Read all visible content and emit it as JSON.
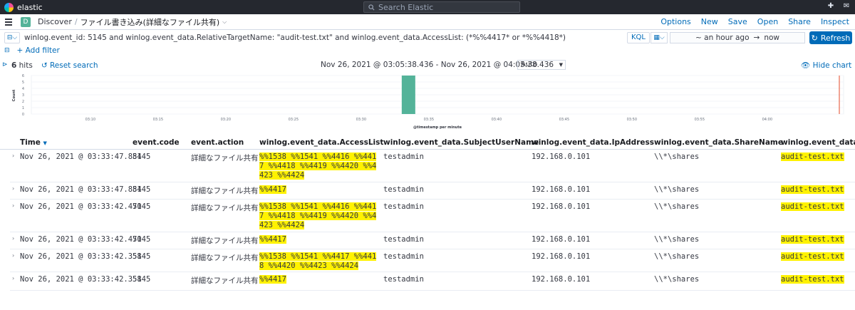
{
  "topbar": {
    "app_name": "elastic",
    "search_placeholder": "Search Elastic"
  },
  "header": {
    "space": "D",
    "breadcrumb_root": "Discover",
    "breadcrumb_sep": "/",
    "breadcrumb_current": "ファイル書き込み(詳細なファイル共有)",
    "links": [
      "Options",
      "New",
      "Save",
      "Open",
      "Share",
      "Inspect"
    ]
  },
  "query": {
    "text": "winlog.event_id: 5145 and winlog.event_data.RelativeTargetName: \"audit-test.txt\"  and winlog.event_data.AccessList: (*%%4417* or *%%4418*)",
    "language": "KQL",
    "date_start": "~ an hour ago",
    "date_arrow": "→",
    "date_end": "now",
    "refresh_label": "Refresh",
    "add_filter": "+ Add filter"
  },
  "summary": {
    "hits_count": "6",
    "hits_label": " hits",
    "reset": "Reset search",
    "time_range": "Nov 26, 2021 @ 03:05:38.436 - Nov 26, 2021 @ 04:05:38.436",
    "interval": "Auto",
    "hide_chart": "Hide chart"
  },
  "chart_data": {
    "type": "bar",
    "x_tick_labels": [
      "03:10",
      "03:15",
      "03:20",
      "03:25",
      "03:30",
      "03:35",
      "03:40",
      "03:45",
      "03:50",
      "03:55",
      "04:00"
    ],
    "y_tick_labels": [
      "0",
      "1",
      "2",
      "3",
      "4",
      "5",
      "6"
    ],
    "ylim": [
      0,
      6
    ],
    "bars": [
      {
        "x": "03:33",
        "value": 6
      }
    ],
    "ylabel": "Count",
    "xlabel": "@timestamp per minute",
    "bar_color": "#54b399",
    "now_line_color": "#e7664c"
  },
  "table": {
    "columns": [
      "Time",
      "event.code",
      "event.action",
      "winlog.event_data.AccessList",
      "winlog.event_data.SubjectUserName",
      "winlog.event_data.IpAddress",
      "winlog.event_data.ShareName",
      "winlog.event_data.Re"
    ],
    "rows": [
      {
        "time": "Nov 26, 2021 @ 03:33:47.884",
        "code": "5145",
        "action": "詳細なファイル共有",
        "access": "%%1538 %%1541 %%4416 %%4417 %%4418 %%4419 %%4420 %%4423 %%4424",
        "user": "testadmin",
        "ip": "192.168.0.101",
        "share": "\\\\*\\shares",
        "target": "audit-test.txt"
      },
      {
        "time": "Nov 26, 2021 @ 03:33:47.884",
        "code": "5145",
        "action": "詳細なファイル共有",
        "access": "%%4417",
        "user": "testadmin",
        "ip": "192.168.0.101",
        "share": "\\\\*\\shares",
        "target": "audit-test.txt"
      },
      {
        "time": "Nov 26, 2021 @ 03:33:42.470",
        "code": "5145",
        "action": "詳細なファイル共有",
        "access": "%%1538 %%1541 %%4416 %%4417 %%4418 %%4419 %%4420 %%4423 %%4424",
        "user": "testadmin",
        "ip": "192.168.0.101",
        "share": "\\\\*\\shares",
        "target": "audit-test.txt"
      },
      {
        "time": "Nov 26, 2021 @ 03:33:42.470",
        "code": "5145",
        "action": "詳細なファイル共有",
        "access": "%%4417",
        "user": "testadmin",
        "ip": "192.168.0.101",
        "share": "\\\\*\\shares",
        "target": "audit-test.txt"
      },
      {
        "time": "Nov 26, 2021 @ 03:33:42.358",
        "code": "5145",
        "action": "詳細なファイル共有",
        "access": "%%1538 %%1541 %%4417 %%4418 %%4420 %%4423 %%4424",
        "user": "testadmin",
        "ip": "192.168.0.101",
        "share": "\\\\*\\shares",
        "target": "audit-test.txt"
      },
      {
        "time": "Nov 26, 2021 @ 03:33:42.358",
        "code": "5145",
        "action": "詳細なファイル共有",
        "access": "%%4417",
        "user": "testadmin",
        "ip": "192.168.0.101",
        "share": "\\\\*\\shares",
        "target": "audit-test.txt"
      }
    ]
  }
}
